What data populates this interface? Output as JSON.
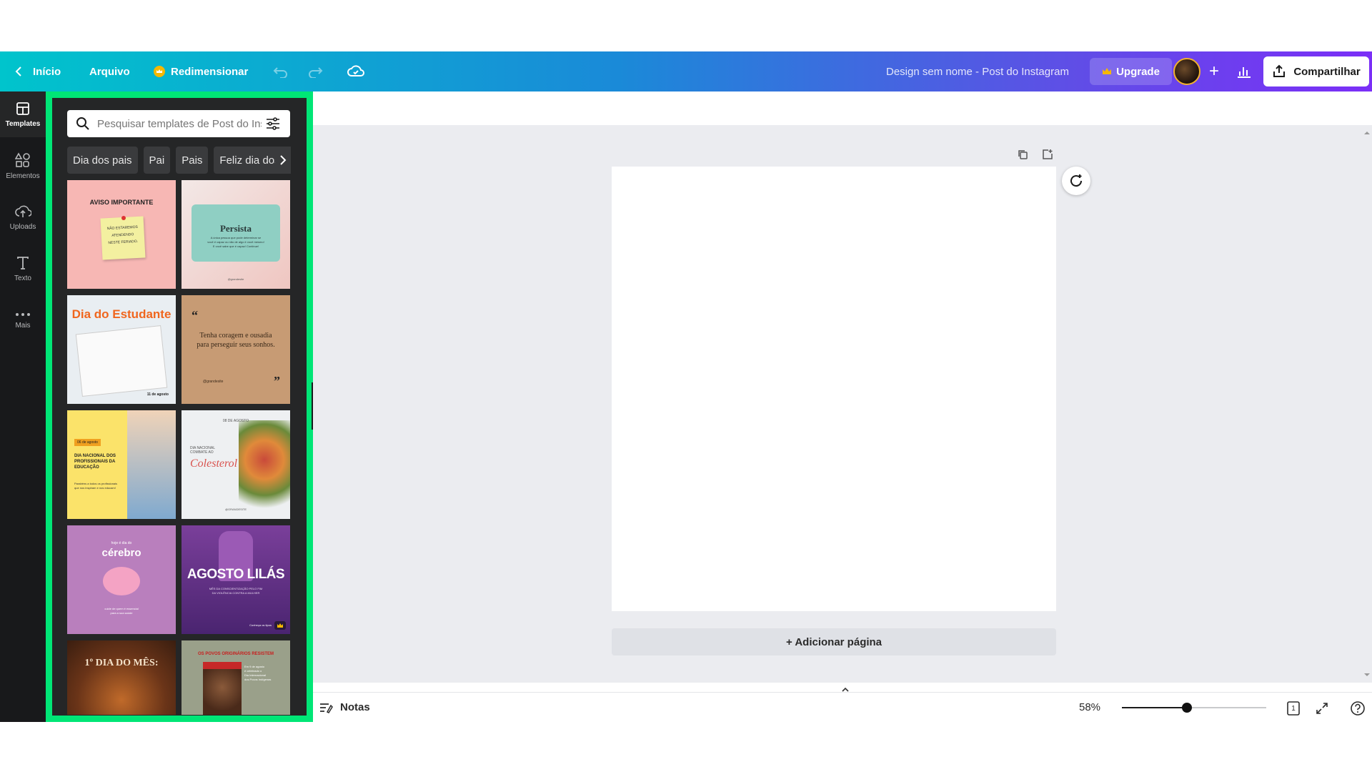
{
  "topbar": {
    "home_label": "Início",
    "file_label": "Arquivo",
    "resize_label": "Redimensionar",
    "design_title": "Design sem nome - Post do Instagram",
    "upgrade_label": "Upgrade",
    "share_label": "Compartilhar"
  },
  "rail": {
    "items": [
      {
        "label": "Templates",
        "icon": "templates-icon"
      },
      {
        "label": "Elementos",
        "icon": "elements-icon"
      },
      {
        "label": "Uploads",
        "icon": "upload-icon"
      },
      {
        "label": "Texto",
        "icon": "text-icon"
      },
      {
        "label": "Mais",
        "icon": "more-icon"
      }
    ]
  },
  "panel": {
    "search_placeholder": "Pesquisar templates de Post do Instagram",
    "chips": [
      "Dia dos pais",
      "Pai",
      "Pais",
      "Feliz dia dos pais"
    ],
    "templates": [
      {
        "title": "AVISO IMPORTANTE",
        "lines": [
          "NÃO ESTAREMOS",
          "ATENDENDO",
          "NESTE FERIADO."
        ]
      },
      {
        "title": "Persista",
        "lines": [
          "A única pessoa que pode determinar se",
          "você é capaz ou não de algo é você mesmo!",
          "E você sabe que é capaz! Continue!"
        ],
        "footer": "@grandesite"
      },
      {
        "title": "Dia do Estudante",
        "footer": "11 de agosto"
      },
      {
        "title": "Tenha coragem e ousadia para perseguir seus sonhos.",
        "footer": "@grandesite"
      },
      {
        "badge": "06 de agosto",
        "title": "DIA NACIONAL DOS PROFISSIONAIS DA EDUCAÇÃO",
        "lines": [
          "Parabéns a todos os profissionais",
          "que nos inspiram e nos educam!"
        ]
      },
      {
        "date": "08 DE AGOSTO",
        "title": "DIA NACIONAL COMBATE AO",
        "script": "Colesterol",
        "footer": "@GRANDESITE"
      },
      {
        "kicker": "hoje é dia do",
        "title": "cérebro",
        "lines": [
          "cuide de quem é essencial",
          "para a sua saúde"
        ]
      },
      {
        "title": "AGOSTO LILÁS",
        "lines": [
          "MÊS DA CONSCIENTIZAÇÃO PELO FIM",
          "DA VIOLÊNCIA CONTRA A MULHER"
        ],
        "footer": "Conheça os tipos"
      },
      {
        "title": "1º DIA DO MÊS:"
      },
      {
        "title": "OS POVOS ORIGINÁRIOS RESISTEM",
        "lines": [
          "Em 9 de agosto",
          "é celebrado o",
          "Dia Internacional",
          "dos Povos Indígenas"
        ]
      }
    ]
  },
  "canvas": {
    "add_page_label": "+ Adicionar página"
  },
  "bottombar": {
    "notes_label": "Notas",
    "zoom_label": "58%",
    "zoom_value": 0.45,
    "page_count": "1"
  },
  "colors": {
    "accent_green": "#00e676",
    "panel_bg": "#252627",
    "rail_bg": "#18191b",
    "canvas_bg": "#ebecf0"
  }
}
